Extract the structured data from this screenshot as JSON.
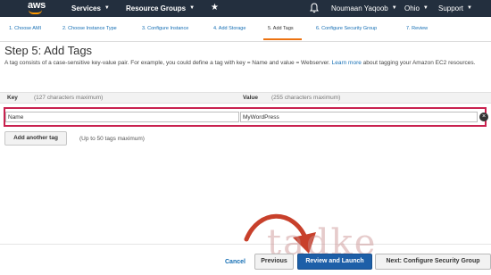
{
  "topbar": {
    "logo": "aws",
    "services": "Services",
    "resource_groups": "Resource Groups",
    "user": "Noumaan Yaqoob",
    "region": "Ohio",
    "support": "Support"
  },
  "steps": [
    {
      "label": "1. Choose AMI"
    },
    {
      "label": "2. Choose Instance Type"
    },
    {
      "label": "3. Configure Instance"
    },
    {
      "label": "4. Add Storage"
    },
    {
      "label": "5. Add Tags"
    },
    {
      "label": "6. Configure Security Group"
    },
    {
      "label": "7. Review"
    }
  ],
  "page": {
    "title": "Step 5: Add Tags",
    "description": "A tag consists of a case-sensitive key-value pair. For example, you could define a tag with key = Name and value = Webserver.",
    "learn_more": "Learn more",
    "description_tail": "about tagging your Amazon EC2 resources."
  },
  "table": {
    "key_header": "Key",
    "key_hint": "(127 characters maximum)",
    "value_header": "Value",
    "value_hint": "(255 characters maximum)",
    "row": {
      "key": "Name",
      "value": "MyWordPress"
    }
  },
  "add_tag": {
    "label": "Add another tag",
    "hint": "(Up to 50 tags maximum)"
  },
  "footer": {
    "cancel": "Cancel",
    "previous": "Previous",
    "review": "Review and Launch",
    "next": "Next: Configure Security Group"
  },
  "watermark": "tadke",
  "colors": {
    "topbar": "#232f3e",
    "accent": "#ec7211",
    "link": "#146eb4",
    "highlight": "#c9224f",
    "primary_button": "#1d5fa8"
  }
}
